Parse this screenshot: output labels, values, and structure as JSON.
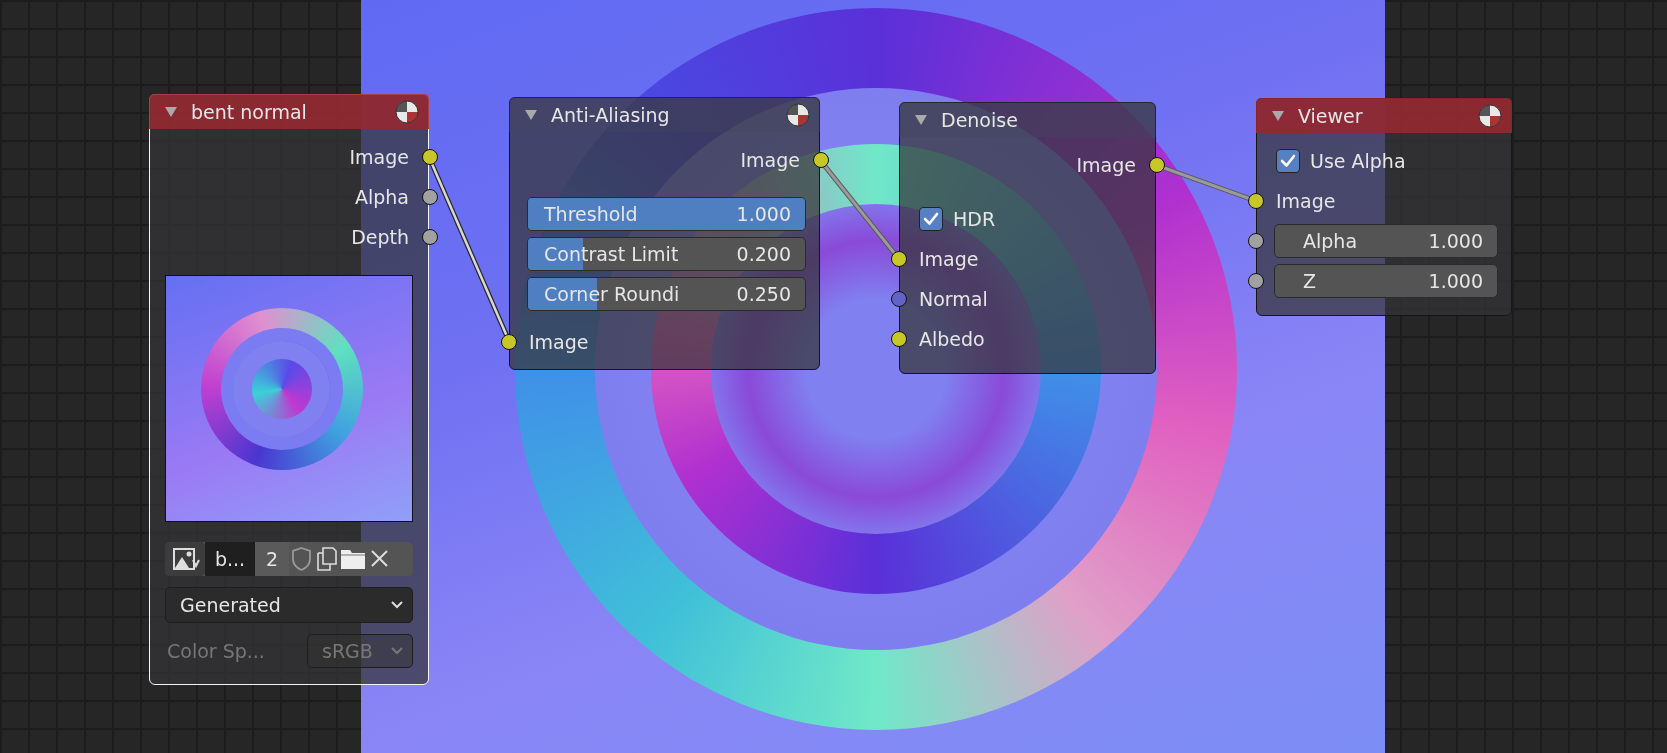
{
  "nodes": [
    {
      "title": "bent normal",
      "kind": "input",
      "selected": true,
      "preview_icon": true,
      "rows": [
        {
          "kind": "output",
          "label": "Image",
          "color": "#c7c729"
        },
        {
          "kind": "output",
          "label": "Alpha",
          "color": "#a1a1a1"
        },
        {
          "kind": "output",
          "label": "Depth",
          "color": "#a1a1a1"
        },
        {
          "kind": "preview"
        },
        {
          "kind": "image-browser",
          "name": "b...",
          "users": "2"
        },
        {
          "kind": "dropdown",
          "value": "Generated"
        },
        {
          "kind": "labeled-dropdown",
          "label": "Color Sp...",
          "value": "sRGB",
          "disabled": true
        }
      ]
    },
    {
      "title": "Anti-Aliasing",
      "kind": "filter",
      "selected": false,
      "preview_icon": true,
      "rows": [
        {
          "kind": "output",
          "label": "Image",
          "color": "#c7c729"
        },
        {
          "kind": "slider",
          "label": "Threshold",
          "value": "1.000",
          "level": 1
        },
        {
          "kind": "slider",
          "label": "Contrast Limit",
          "value": "0.200",
          "level": 0.2
        },
        {
          "kind": "slider",
          "label": "Corner Roundi",
          "value": "0.250",
          "level": 0.25
        },
        {
          "kind": "input",
          "label": "Image",
          "color": "#c7c729"
        }
      ]
    },
    {
      "title": "Denoise",
      "kind": "filter",
      "selected": false,
      "preview_icon": false,
      "rows": [
        {
          "kind": "output",
          "label": "Image",
          "color": "#c7c729"
        },
        {
          "kind": "checkbox",
          "label": "HDR",
          "checked": true
        },
        {
          "kind": "input",
          "label": "Image",
          "color": "#c7c729"
        },
        {
          "kind": "input",
          "label": "Normal",
          "color": "#6363c7"
        },
        {
          "kind": "input",
          "label": "Albedo",
          "color": "#c7c729"
        }
      ]
    },
    {
      "title": "Viewer",
      "kind": "output",
      "selected": false,
      "preview_icon": true,
      "rows": [
        {
          "kind": "checkbox",
          "label": "Use Alpha",
          "checked": true
        },
        {
          "kind": "input",
          "label": "Image",
          "color": "#c7c729"
        },
        {
          "kind": "value",
          "label": "Alpha",
          "value": "1.000",
          "color": "#a1a1a1"
        },
        {
          "kind": "value",
          "label": "Z",
          "value": "1.000",
          "color": "#a1a1a1"
        }
      ]
    }
  ]
}
